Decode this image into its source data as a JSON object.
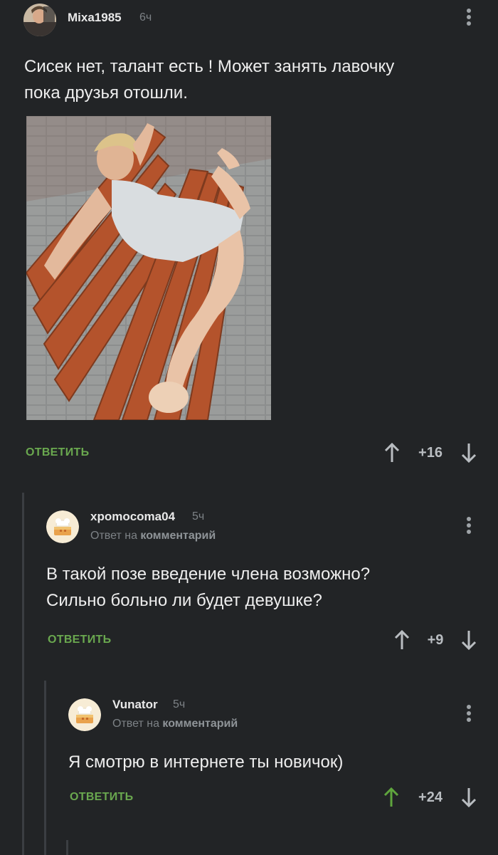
{
  "comments": [
    {
      "author": "Mixa1985",
      "time": "6ч",
      "text_lines": [
        "Сисек нет, талант есть ! Может занять лавочку",
        "пока друзья отошли."
      ],
      "reply_label": "ОТВЕТИТЬ",
      "score": "+16"
    },
    {
      "author": "xpomocoma04",
      "time": "5ч",
      "reply_prefix": "Ответ на",
      "reply_target": "комментарий",
      "text_lines": [
        "В такой позе введение члена возможно?",
        "Сильно больно ли будет девушке?"
      ],
      "reply_label": "ОТВЕТИТЬ",
      "score": "+9"
    },
    {
      "author": "Vunator",
      "time": "5ч",
      "reply_prefix": "Ответ на",
      "reply_target": "комментарий",
      "text_lines": [
        "Я смотрю в интернете ты новичок)"
      ],
      "reply_label": "ОТВЕТИТЬ",
      "score": "+24",
      "upvoted": true
    }
  ],
  "colors": {
    "background": "#222426",
    "reply_green": "#6aa84f",
    "upvote_active": "#5fa53d",
    "muted": "#7d8286"
  },
  "icons": [
    "avatar-photo",
    "avatar-default-cake",
    "more-vertical-icon",
    "arrow-up-icon",
    "arrow-down-icon"
  ]
}
